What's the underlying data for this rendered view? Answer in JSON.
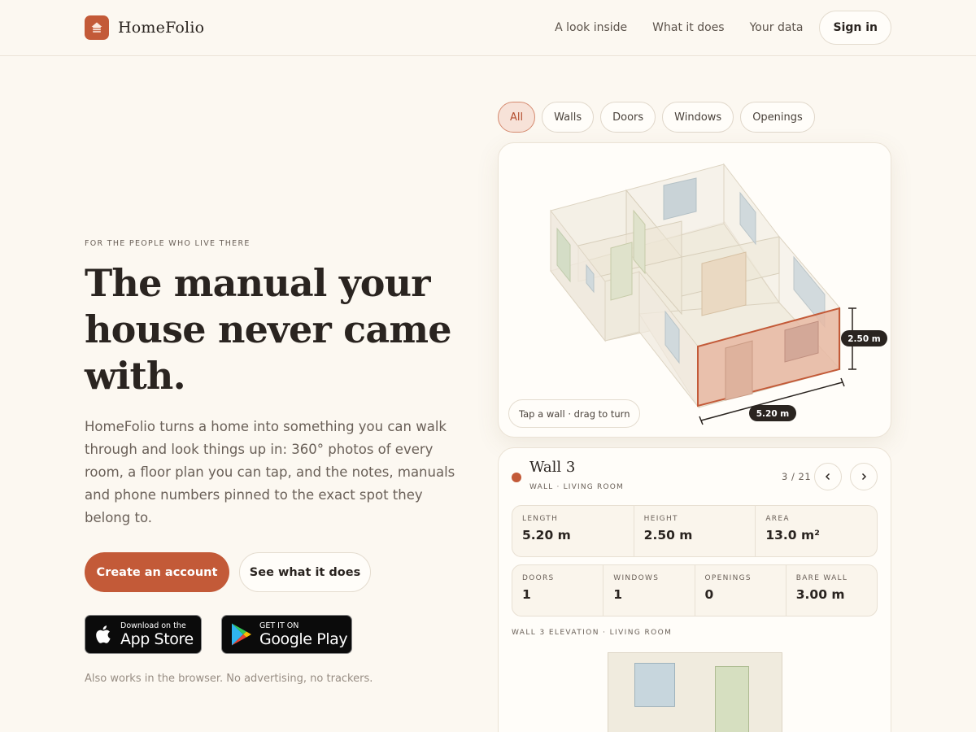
{
  "brand": {
    "name": "HomeFolio",
    "accent": "#c35a38"
  },
  "nav": {
    "links": [
      "A look inside",
      "What it does",
      "Your data"
    ],
    "signin": "Sign in"
  },
  "hero": {
    "eyebrow": "FOR THE PEOPLE WHO LIVE THERE",
    "headline": "The manual your house never came with.",
    "lede": "HomeFolio turns a home into something you can walk through and look things up in: 360° photos of every room, a floor plan you can tap, and the notes, manuals and phone numbers pinned to the exact spot they belong to.",
    "primary_cta": "Create an account",
    "secondary_cta": "See what it does",
    "app_store": {
      "small": "Download on the",
      "big": "App Store"
    },
    "google_play": {
      "small": "GET IT ON",
      "big": "Google Play"
    },
    "footnote": "Also works in the browser. No advertising, no trackers."
  },
  "filters": {
    "chips": [
      "All",
      "Walls",
      "Doors",
      "Windows",
      "Openings"
    ],
    "active": "All"
  },
  "viewer": {
    "hint": "Tap a wall · drag to turn",
    "height_label": "2.50 m",
    "length_label": "5.20 m"
  },
  "detail": {
    "title": "Wall 3",
    "subtitle": "WALL · LIVING ROOM",
    "counter": "3 / 21",
    "prev_icon": "chevron-left-icon",
    "next_icon": "chevron-right-icon",
    "row1": [
      {
        "label": "LENGTH",
        "value": "5.20 m"
      },
      {
        "label": "HEIGHT",
        "value": "2.50 m"
      },
      {
        "label": "AREA",
        "value": "13.0 m²"
      }
    ],
    "row2": [
      {
        "label": "DOORS",
        "value": "1"
      },
      {
        "label": "WINDOWS",
        "value": "1"
      },
      {
        "label": "OPENINGS",
        "value": "0"
      },
      {
        "label": "BARE WALL",
        "value": "3.00 m"
      }
    ],
    "elevation_label": "WALL 3 ELEVATION · LIVING ROOM"
  }
}
